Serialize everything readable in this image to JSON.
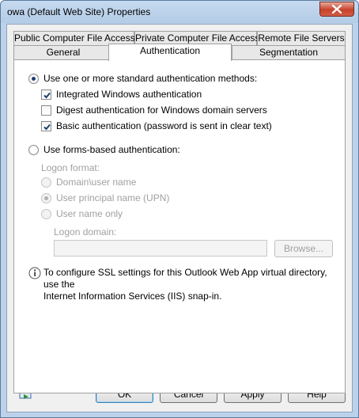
{
  "window": {
    "title": "owa (Default Web Site) Properties"
  },
  "tabs": {
    "top_row": [
      "Public Computer File Access",
      "Private Computer File Access",
      "Remote File Servers"
    ],
    "bottom_row": [
      "General",
      "Authentication",
      "Segmentation"
    ],
    "active": "Authentication"
  },
  "auth": {
    "standard_label": "Use one or more standard authentication methods:",
    "standard_selected": true,
    "methods": [
      {
        "label": "Integrated Windows authentication",
        "checked": true
      },
      {
        "label": "Digest authentication for Windows domain servers",
        "checked": false
      },
      {
        "label": "Basic authentication (password is sent in clear text)",
        "checked": true
      }
    ],
    "forms_label": "Use forms-based authentication:",
    "forms_selected": false,
    "logon_format_label": "Logon format:",
    "logon_formats": [
      {
        "label": "Domain\\user name",
        "selected": false
      },
      {
        "label": "User principal name (UPN)",
        "selected": true
      },
      {
        "label": "User name only",
        "selected": false
      }
    ],
    "logon_domain_label": "Logon domain:",
    "logon_domain_value": "",
    "browse_label": "Browse..."
  },
  "info": {
    "line1": "To configure SSL settings for this Outlook Web App virtual directory, use the",
    "line2": "Internet Information Services (IIS) snap-in."
  },
  "buttons": {
    "ok": "OK",
    "cancel": "Cancel",
    "apply": "Apply",
    "help": "Help"
  },
  "icons": {
    "close": "close-icon",
    "info": "info-icon",
    "help": "help-icon"
  }
}
